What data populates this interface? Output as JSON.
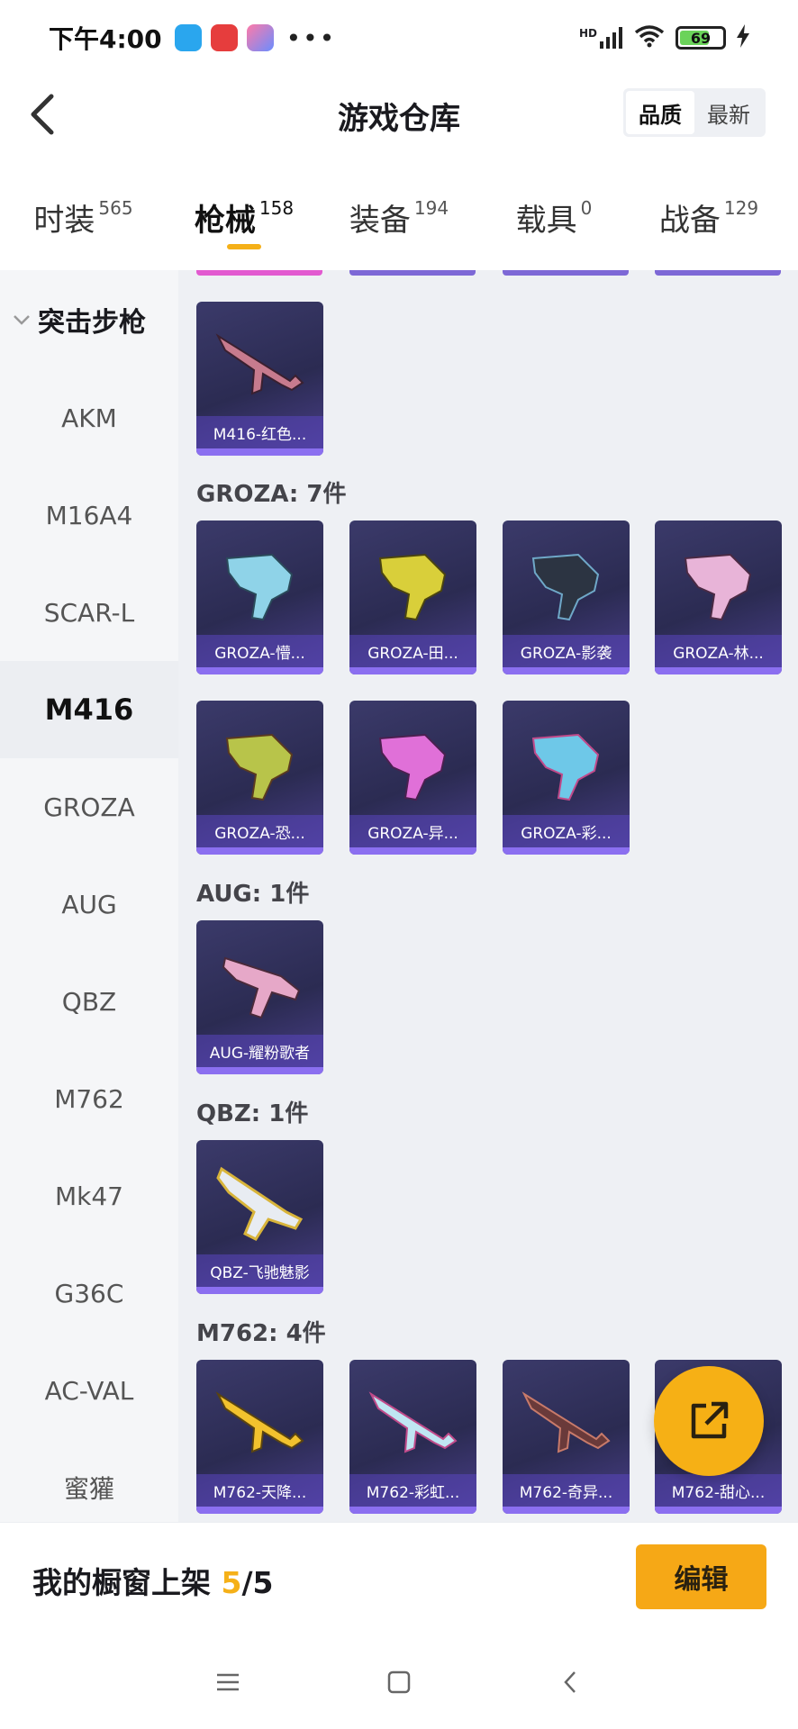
{
  "status_bar": {
    "time": "下午4:00",
    "signal": "HD",
    "battery": "69",
    "battery_level": 0.69
  },
  "header": {
    "title": "游戏仓库",
    "sort_options": [
      "品质",
      "最新"
    ],
    "sort_active": "品质"
  },
  "tabs": [
    {
      "label": "时装",
      "count": "565"
    },
    {
      "label": "枪械",
      "count": "158"
    },
    {
      "label": "装备",
      "count": "194"
    },
    {
      "label": "载具",
      "count": "0"
    },
    {
      "label": "战备",
      "count": "129"
    }
  ],
  "active_tab": "枪械",
  "sidebar": {
    "header": "突击步枪",
    "items": [
      "AKM",
      "M16A4",
      "SCAR-L",
      "M416",
      "GROZA",
      "AUG",
      "QBZ",
      "M762",
      "Mk47",
      "G36C",
      "AC-VAL",
      "蜜獾"
    ],
    "active": "M416"
  },
  "sections": [
    {
      "title": "",
      "cards": [
        "M416-红色..."
      ]
    },
    {
      "title": "GROZA: 7件",
      "cards": [
        "GROZA-懵...",
        "GROZA-田...",
        "GROZA-影袭",
        "GROZA-林...",
        "GROZA-恐...",
        "GROZA-异...",
        "GROZA-彩..."
      ]
    },
    {
      "title": "AUG: 1件",
      "cards": [
        "AUG-耀粉歌者"
      ]
    },
    {
      "title": "QBZ: 1件",
      "cards": [
        "QBZ-飞驰魅影"
      ]
    },
    {
      "title": "M762: 4件",
      "cards": [
        "M762-天降...",
        "M762-彩虹...",
        "M762-奇异...",
        "M762-甜心..."
      ]
    }
  ],
  "bottom_bar": {
    "label": "我的橱窗上架",
    "count_current": "5",
    "count_total": "/5",
    "edit_label": "编辑"
  },
  "colors": {
    "accent": "#f5b018",
    "card_bg": "#2d2c58",
    "card_label": "#5a46be"
  }
}
